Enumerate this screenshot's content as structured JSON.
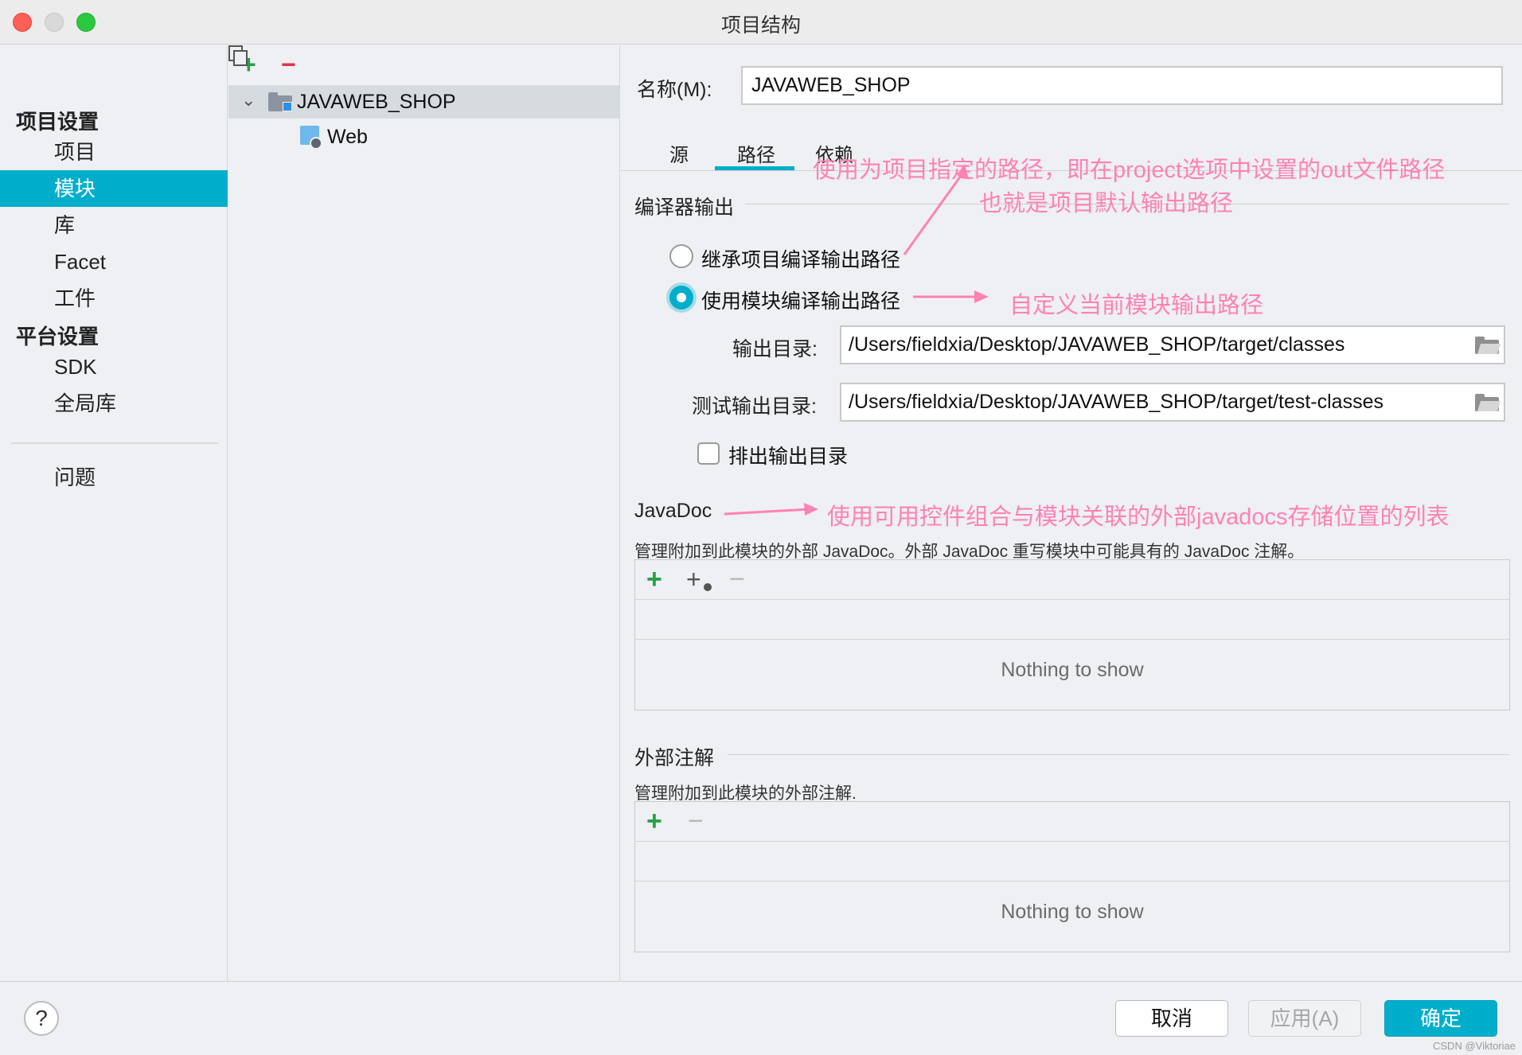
{
  "window": {
    "title": "项目结构"
  },
  "nav": {
    "back_icon": "arrow-left-icon",
    "forward_icon": "arrow-right-icon",
    "project_settings_header": "项目设置",
    "platform_settings_header": "平台设置",
    "items": [
      {
        "label": "项目",
        "selected": false
      },
      {
        "label": "模块",
        "selected": true
      },
      {
        "label": "库",
        "selected": false
      },
      {
        "label": "Facet",
        "selected": false
      },
      {
        "label": "工件",
        "selected": false
      },
      {
        "label": "SDK",
        "selected": false
      },
      {
        "label": "全局库",
        "selected": false
      },
      {
        "label": "问题",
        "selected": false
      }
    ]
  },
  "tree": {
    "toolbar": {
      "add": "+",
      "remove": "−",
      "copy_icon": "copy-icon"
    },
    "root_label": "JAVAWEB_SHOP",
    "child_label": "Web"
  },
  "panel": {
    "name_label": "名称(M):",
    "name_value": "JAVAWEB_SHOP",
    "tabs": [
      {
        "label": "源",
        "selected": false
      },
      {
        "label": "路径",
        "selected": true
      },
      {
        "label": "依赖",
        "selected": false
      }
    ],
    "compiler_output": {
      "title": "编译器输出",
      "inherit_label": "继承项目编译输出路径",
      "use_module_label": "使用模块编译输出路径",
      "selected_option": "使用模块编译输出路径",
      "output_dir_label": "输出目录:",
      "output_dir_value": "/Users/fieldxia/Desktop/JAVAWEB_SHOP/target/classes",
      "test_output_dir_label": "测试输出目录:",
      "test_output_dir_value": "/Users/fieldxia/Desktop/JAVAWEB_SHOP/target/test-classes",
      "exclude_label": "排出输出目录",
      "exclude_checked": false
    },
    "javadoc": {
      "title": "JavaDoc",
      "description": "管理附加到此模块的外部 JavaDoc。外部 JavaDoc 重写模块中可能具有的 JavaDoc 注解。",
      "empty_text": "Nothing to show"
    },
    "external_annotations": {
      "title": "外部注解",
      "description": "管理附加到此模块的外部注解.",
      "empty_text": "Nothing to show"
    }
  },
  "footer": {
    "help": "?",
    "cancel": "取消",
    "apply": "应用(A)",
    "ok": "确定",
    "watermark": "CSDN @Viktoriae"
  },
  "annotations": {
    "inherit_note_line1": "使用为项目指定的路径，即在project选项中设置的out文件路径",
    "inherit_note_line2": "也就是项目默认输出路径",
    "module_note": "自定义当前模块输出路径",
    "javadoc_note": "使用可用控件组合与模块关联的外部javadocs存储位置的列表",
    "color": "#ff82b4"
  },
  "colors": {
    "accent": "#00aecb",
    "add_green": "#24a148",
    "remove_red": "#e5304f",
    "annotation_pink": "#ff82b4"
  }
}
